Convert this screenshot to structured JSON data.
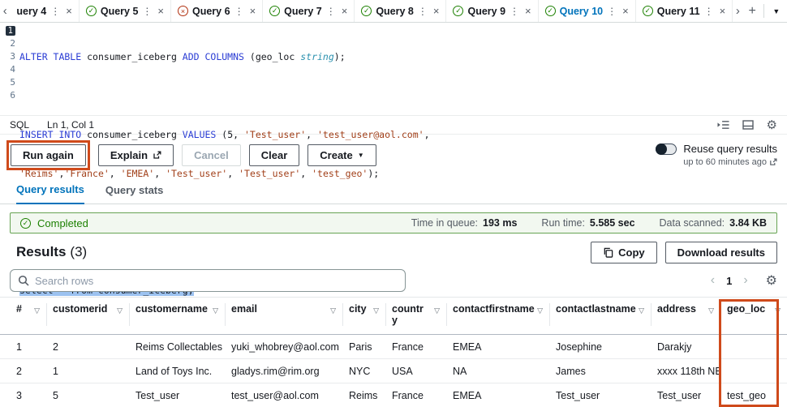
{
  "colors": {
    "annotation": "#cf4a1b",
    "active_tab_blue": "#0073bb",
    "success_green": "#1d8102"
  },
  "icons": {
    "check": "✓",
    "close": "×",
    "kebab": "⋮",
    "caret_down": "▼",
    "plus": "+",
    "scroll_left": "‹",
    "scroll_right": "›",
    "external": "↗",
    "gear": "⚙",
    "filter": "▽",
    "page_prev": "‹",
    "page_next": "›"
  },
  "tabbar": {
    "tabs": [
      {
        "label": "uery 4"
      },
      {
        "label": "Query 5"
      },
      {
        "label": "Query 6"
      },
      {
        "label": "Query 7"
      },
      {
        "label": "Query 8"
      },
      {
        "label": "Query 9"
      },
      {
        "label": "Query 10"
      },
      {
        "label": "Query 11"
      }
    ]
  },
  "editor": {
    "line_numbers": [
      "1",
      "2",
      "3",
      "4",
      "5",
      "6"
    ],
    "code": {
      "l1": {
        "k1": "ALTER TABLE",
        "p1": " consumer_iceberg ",
        "k2": "ADD COLUMNS",
        "p2": " (geo_loc ",
        "t1": "string",
        "p3": ");"
      },
      "l3": {
        "k1": "INSERT INTO",
        "p1": " consumer_iceberg ",
        "k2": "VALUES",
        "p2": " (5, ",
        "s1": "'Test_user'",
        "p3": ", ",
        "s2": "'test_user@aol.com'",
        "p4": ","
      },
      "l4": {
        "s1": "'Reims'",
        "p1": ",",
        "s2": "'France'",
        "p2": ", ",
        "s3": "'EMEA'",
        "p3": ", ",
        "s4": "'Test_user'",
        "p4": ", ",
        "s5": "'Test_user'",
        "p5": ", ",
        "s6": "'test_geo'",
        "p6": ");"
      },
      "l7": "select * from consumer_iceberg;"
    }
  },
  "statusbar": {
    "language": "SQL",
    "cursor_position": "Ln 1, Col 1"
  },
  "actions": {
    "run_again": "Run again",
    "explain": "Explain",
    "cancel": "Cancel",
    "clear": "Clear",
    "create": "Create",
    "reuse_label": "Reuse query results",
    "reuse_note": "up to 60 minutes ago"
  },
  "result_tabs": {
    "results": "Query results",
    "stats": "Query stats"
  },
  "banner": {
    "status": "Completed",
    "metrics": [
      {
        "label": "Time in queue:",
        "value": "193 ms"
      },
      {
        "label": "Run time:",
        "value": "5.585 sec"
      },
      {
        "label": "Data scanned:",
        "value": "3.84 KB"
      }
    ]
  },
  "results": {
    "title": "Results",
    "count": "(3)",
    "copy": "Copy",
    "download": "Download results",
    "search_placeholder": "Search rows",
    "current_page": "1"
  },
  "table": {
    "columns": [
      "#",
      "customerid",
      "customername",
      "email",
      "city",
      "country",
      "contactfirstname",
      "contactlastname",
      "address",
      "geo_loc"
    ],
    "rows": [
      [
        "1",
        "2",
        "Reims Collectables",
        "yuki_whobrey@aol.com",
        "Paris",
        "France",
        "EMEA",
        "Josephine",
        "Darakjy",
        ""
      ],
      [
        "2",
        "1",
        "Land of Toys Inc.",
        "gladys.rim@rim.org",
        "NYC",
        "USA",
        "NA",
        "James",
        "xxxx 118th NE",
        ""
      ],
      [
        "3",
        "5",
        "Test_user",
        "test_user@aol.com",
        "Reims",
        "France",
        "EMEA",
        "Test_user",
        "Test_user",
        "test_geo"
      ]
    ]
  }
}
